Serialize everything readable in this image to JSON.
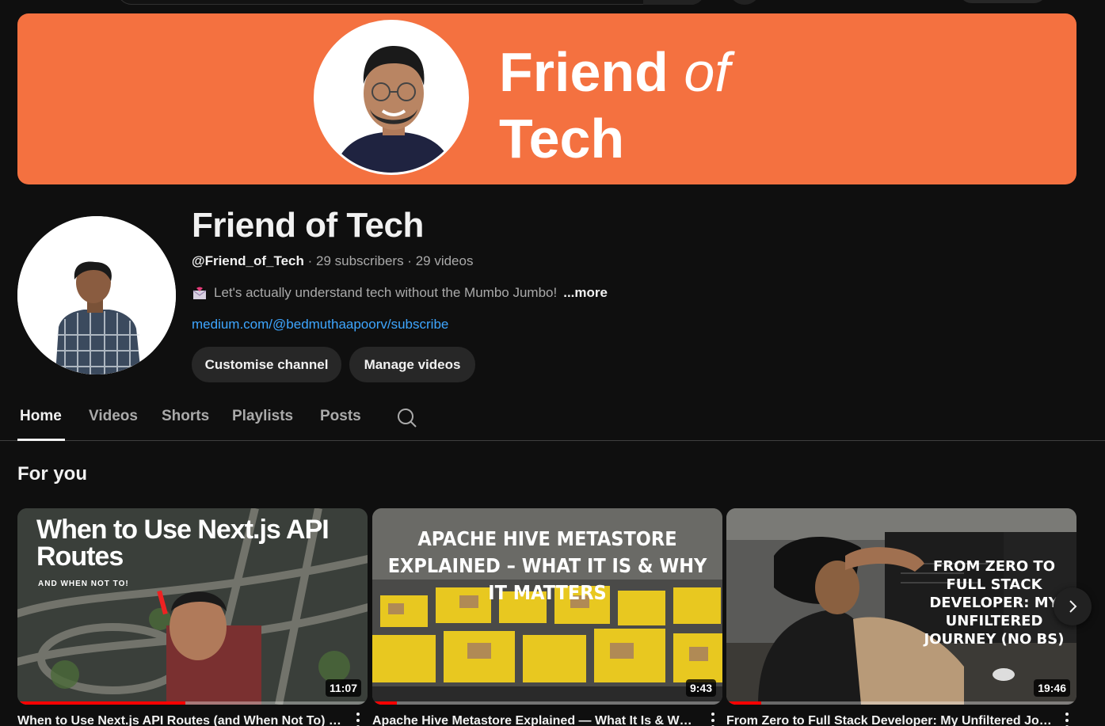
{
  "banner": {
    "line1_main": "Friend",
    "line1_of": "of",
    "line2": "Tech",
    "color": "#f47140"
  },
  "channel": {
    "title": "Friend of Tech",
    "handle": "@Friend_of_Tech",
    "subscribers": "29 subscribers",
    "videos": "29 videos",
    "separator": " · ",
    "description": "Let's actually understand tech without the Mumbo Jumbo!",
    "more": "...more",
    "link": "medium.com/@bedmuthaapoorv/subscribe"
  },
  "buttons": {
    "customise": "Customise channel",
    "manage": "Manage videos"
  },
  "tabs": [
    {
      "label": "Home",
      "active": true
    },
    {
      "label": "Videos",
      "active": false
    },
    {
      "label": "Shorts",
      "active": false
    },
    {
      "label": "Playlists",
      "active": false
    },
    {
      "label": "Posts",
      "active": false
    }
  ],
  "section": {
    "title": "For you"
  },
  "videos": [
    {
      "thumb_title": "When to Use Next.js API Routes",
      "thumb_subtitle": "AND WHEN NOT TO!",
      "duration": "11:07",
      "title": "When to Use Next.js API Routes (and When Not To) | Next.js",
      "progress": 0.48
    },
    {
      "thumb_title": "APACHE HIVE METASTORE EXPLAINED – WHAT IT IS & WHY IT MATTERS",
      "duration": "9:43",
      "title": "Apache Hive Metastore Explained — What It Is & Why It Matters",
      "progress": 0.07
    },
    {
      "thumb_title": "FROM ZERO TO FULL STACK DEVELOPER: MY UNFILTERED JOURNEY (NO BS)",
      "duration": "19:46",
      "title": "From Zero to Full Stack Developer: My Unfiltered Journey (No BS)",
      "progress": 0.1
    }
  ]
}
